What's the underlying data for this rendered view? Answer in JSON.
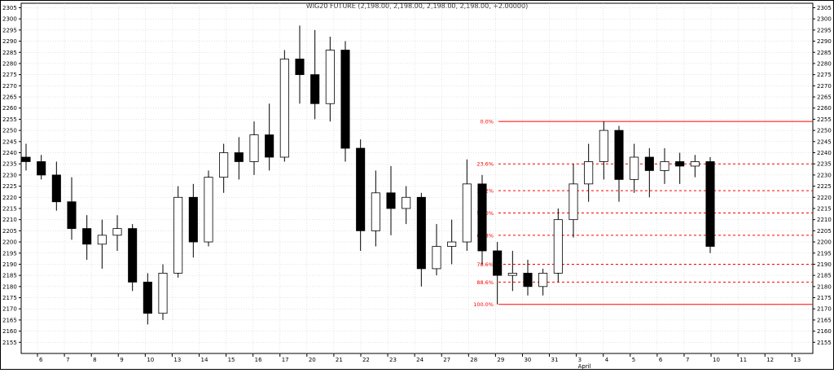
{
  "chart_data": {
    "type": "candlestick",
    "title": "WIG20 FUTURE (2,198.00, 2,198.00, 2,198.00, 2,198.00, +2.00000)",
    "ylim": [
      2150,
      2307
    ],
    "y_ticks": [
      2155,
      2160,
      2165,
      2170,
      2175,
      2180,
      2185,
      2190,
      2195,
      2200,
      2205,
      2210,
      2215,
      2220,
      2225,
      2230,
      2235,
      2240,
      2245,
      2250,
      2255,
      2260,
      2265,
      2270,
      2275,
      2280,
      2285,
      2290,
      2295,
      2300,
      2305
    ],
    "x_labels": [
      "6",
      "7",
      "8",
      "9",
      "10",
      "13",
      "14",
      "15",
      "16",
      "17",
      "20",
      "21",
      "22",
      "23",
      "24",
      "27",
      "28",
      "29",
      "30",
      "31",
      "3",
      "4",
      "5",
      "6",
      "7",
      "10",
      "11",
      "12",
      "13"
    ],
    "month_label": "April",
    "grid": true,
    "fib_levels": [
      {
        "label": "0.0%",
        "value": 2254
      },
      {
        "label": "23.6%",
        "value": 2235
      },
      {
        "label": "38.2%",
        "value": 2223
      },
      {
        "label": "50.0%",
        "value": 2213
      },
      {
        "label": "61.8%",
        "value": 2203
      },
      {
        "label": "78.6%",
        "value": 2190
      },
      {
        "label": "88.6%",
        "value": 2182
      },
      {
        "label": "100.0%",
        "value": 2172
      }
    ],
    "colors": {
      "up": "#ffffff",
      "down": "#000000",
      "fib": "#ff0000",
      "grid": "#c8c8c8"
    },
    "series": [
      {
        "x": 0,
        "o": 2238,
        "h": 2244,
        "l": 2232,
        "c": 2236
      },
      {
        "x": 1,
        "o": 2236,
        "h": 2239,
        "l": 2228,
        "c": 2230
      },
      {
        "x": 2,
        "o": 2230,
        "h": 2236,
        "l": 2214,
        "c": 2218
      },
      {
        "x": 3,
        "o": 2218,
        "h": 2229,
        "l": 2201,
        "c": 2206
      },
      {
        "x": 4,
        "o": 2206,
        "h": 2212,
        "l": 2192,
        "c": 2199
      },
      {
        "x": 5,
        "o": 2199,
        "h": 2210,
        "l": 2188,
        "c": 2203
      },
      {
        "x": 6,
        "o": 2203,
        "h": 2212,
        "l": 2196,
        "c": 2206
      },
      {
        "x": 7,
        "o": 2206,
        "h": 2208,
        "l": 2178,
        "c": 2182
      },
      {
        "x": 8,
        "o": 2182,
        "h": 2186,
        "l": 2163,
        "c": 2168
      },
      {
        "x": 9,
        "o": 2168,
        "h": 2190,
        "l": 2165,
        "c": 2186
      },
      {
        "x": 10,
        "o": 2186,
        "h": 2225,
        "l": 2184,
        "c": 2220
      },
      {
        "x": 11,
        "o": 2220,
        "h": 2226,
        "l": 2193,
        "c": 2200
      },
      {
        "x": 12,
        "o": 2200,
        "h": 2232,
        "l": 2198,
        "c": 2229
      },
      {
        "x": 13,
        "o": 2229,
        "h": 2244,
        "l": 2222,
        "c": 2240
      },
      {
        "x": 14,
        "o": 2240,
        "h": 2247,
        "l": 2228,
        "c": 2236
      },
      {
        "x": 15,
        "o": 2236,
        "h": 2254,
        "l": 2230,
        "c": 2248
      },
      {
        "x": 16,
        "o": 2248,
        "h": 2262,
        "l": 2232,
        "c": 2238
      },
      {
        "x": 17,
        "o": 2238,
        "h": 2286,
        "l": 2236,
        "c": 2282
      },
      {
        "x": 18,
        "o": 2282,
        "h": 2297,
        "l": 2262,
        "c": 2275
      },
      {
        "x": 19,
        "o": 2275,
        "h": 2295,
        "l": 2255,
        "c": 2262
      },
      {
        "x": 20,
        "o": 2262,
        "h": 2292,
        "l": 2254,
        "c": 2286
      },
      {
        "x": 21,
        "o": 2286,
        "h": 2290,
        "l": 2236,
        "c": 2242
      },
      {
        "x": 22,
        "o": 2242,
        "h": 2246,
        "l": 2196,
        "c": 2205
      },
      {
        "x": 23,
        "o": 2205,
        "h": 2232,
        "l": 2198,
        "c": 2222
      },
      {
        "x": 24,
        "o": 2222,
        "h": 2234,
        "l": 2203,
        "c": 2215
      },
      {
        "x": 25,
        "o": 2215,
        "h": 2225,
        "l": 2208,
        "c": 2220
      },
      {
        "x": 26,
        "o": 2220,
        "h": 2222,
        "l": 2180,
        "c": 2188
      },
      {
        "x": 27,
        "o": 2188,
        "h": 2208,
        "l": 2185,
        "c": 2198
      },
      {
        "x": 28,
        "o": 2198,
        "h": 2210,
        "l": 2190,
        "c": 2200
      },
      {
        "x": 29,
        "o": 2200,
        "h": 2237,
        "l": 2196,
        "c": 2226
      },
      {
        "x": 30,
        "o": 2226,
        "h": 2230,
        "l": 2190,
        "c": 2196
      },
      {
        "x": 31,
        "o": 2196,
        "h": 2200,
        "l": 2172,
        "c": 2185
      },
      {
        "x": 32,
        "o": 2185,
        "h": 2196,
        "l": 2178,
        "c": 2186
      },
      {
        "x": 33,
        "o": 2186,
        "h": 2192,
        "l": 2176,
        "c": 2180
      },
      {
        "x": 34,
        "o": 2180,
        "h": 2188,
        "l": 2176,
        "c": 2186
      },
      {
        "x": 35,
        "o": 2186,
        "h": 2215,
        "l": 2182,
        "c": 2210
      },
      {
        "x": 36,
        "o": 2210,
        "h": 2235,
        "l": 2202,
        "c": 2226
      },
      {
        "x": 37,
        "o": 2226,
        "h": 2244,
        "l": 2218,
        "c": 2236
      },
      {
        "x": 38,
        "o": 2236,
        "h": 2254,
        "l": 2228,
        "c": 2250
      },
      {
        "x": 39,
        "o": 2250,
        "h": 2252,
        "l": 2218,
        "c": 2228
      },
      {
        "x": 40,
        "o": 2228,
        "h": 2244,
        "l": 2222,
        "c": 2238
      },
      {
        "x": 41,
        "o": 2238,
        "h": 2242,
        "l": 2220,
        "c": 2232
      },
      {
        "x": 42,
        "o": 2232,
        "h": 2242,
        "l": 2226,
        "c": 2236
      },
      {
        "x": 43,
        "o": 2236,
        "h": 2240,
        "l": 2226,
        "c": 2234
      },
      {
        "x": 44,
        "o": 2234,
        "h": 2239,
        "l": 2229,
        "c": 2236
      },
      {
        "x": 45,
        "o": 2236,
        "h": 2238,
        "l": 2195,
        "c": 2198
      }
    ]
  }
}
